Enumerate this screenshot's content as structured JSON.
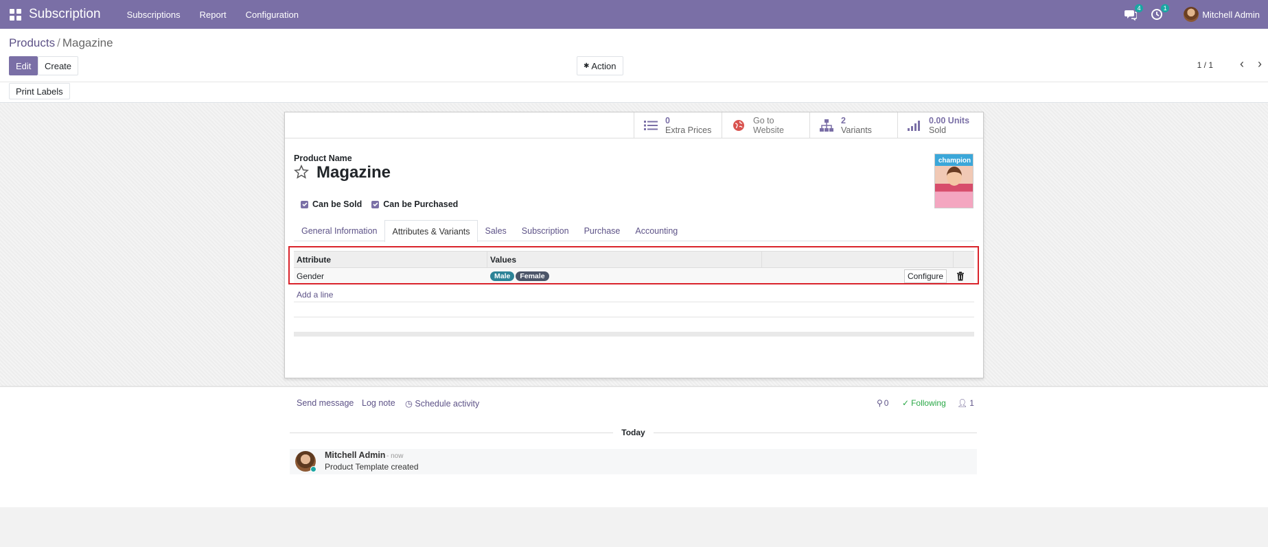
{
  "nav": {
    "app_title": "Subscription",
    "menu": [
      "Subscriptions",
      "Report",
      "Configuration"
    ],
    "messages_count": "4",
    "activities_count": "1",
    "user_name": "Mitchell Admin"
  },
  "control": {
    "breadcrumb_parent": "Products",
    "breadcrumb_sep": "/",
    "breadcrumb_current": "Magazine",
    "edit_label": "Edit",
    "create_label": "Create",
    "action_label": "Action",
    "print_labels": "Print Labels",
    "pager": "1 / 1"
  },
  "smart_buttons": [
    {
      "value": "0",
      "label": "Extra Prices",
      "icon": "list-icon"
    },
    {
      "value": "Go to",
      "label": "Website",
      "icon": "globe-icon"
    },
    {
      "value": "2",
      "label": "Variants",
      "icon": "sitemap-icon"
    },
    {
      "value": "0.00 Units",
      "label": "Sold",
      "icon": "signal-icon"
    }
  ],
  "product": {
    "name_label": "Product Name",
    "name": "Magazine",
    "image_masthead": "champion",
    "can_be_sold_label": "Can be Sold",
    "can_be_sold": true,
    "can_be_purchased_label": "Can be Purchased",
    "can_be_purchased": true
  },
  "tabs": [
    {
      "label": "General Information",
      "active": false
    },
    {
      "label": "Attributes & Variants",
      "active": true
    },
    {
      "label": "Sales",
      "active": false
    },
    {
      "label": "Subscription",
      "active": false
    },
    {
      "label": "Purchase",
      "active": false
    },
    {
      "label": "Accounting",
      "active": false
    }
  ],
  "attributes_table": {
    "headers": [
      "Attribute",
      "Values"
    ],
    "rows": [
      {
        "attribute": "Gender",
        "values": [
          {
            "label": "Male",
            "color": "#2c8397"
          },
          {
            "label": "Female",
            "color": "#4b5568"
          }
        ],
        "configure_label": "Configure"
      }
    ],
    "add_line": "Add a line"
  },
  "chatter": {
    "send_message": "Send message",
    "log_note": "Log note",
    "schedule_activity": "Schedule activity",
    "attachments": "0",
    "following": "Following",
    "followers": "1",
    "today": "Today",
    "message": {
      "author": "Mitchell Admin",
      "date": "- now",
      "body": "Product Template created"
    }
  },
  "colors": {
    "brand": "#7a6fa6",
    "link": "#5d5287",
    "following": "#28a745",
    "highlight": "#d9222a"
  }
}
